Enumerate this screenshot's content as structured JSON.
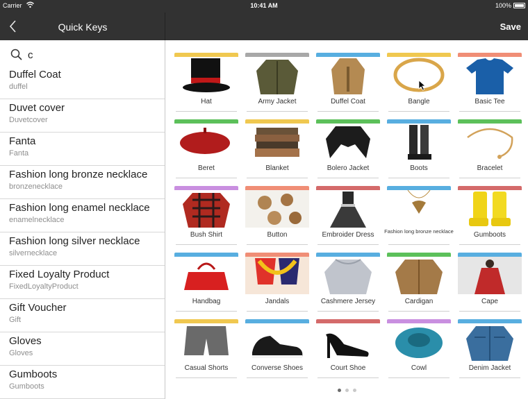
{
  "status_bar": {
    "carrier": "Carrier",
    "time": "10:41 AM",
    "battery": "100%"
  },
  "nav": {
    "title": "Quick Keys",
    "save": "Save"
  },
  "search": {
    "value": "c"
  },
  "list": [
    {
      "title": "Duffel Coat",
      "sub": "duffel"
    },
    {
      "title": "Duvet cover",
      "sub": "Duvetcover"
    },
    {
      "title": "Fanta",
      "sub": "Fanta"
    },
    {
      "title": "Fashion long bronze necklace",
      "sub": "bronzenecklace"
    },
    {
      "title": "Fashion long enamel necklace",
      "sub": "enamelnecklace"
    },
    {
      "title": "Fashion long silver necklace",
      "sub": "silvernecklace"
    },
    {
      "title": "Fixed Loyalty Product",
      "sub": "FixedLoyaltyProduct"
    },
    {
      "title": "Gift Voucher",
      "sub": "Gift"
    },
    {
      "title": "Gloves",
      "sub": "Gloves"
    },
    {
      "title": "Gumboots",
      "sub": "Gumboots"
    }
  ],
  "tiles": [
    {
      "label": "Hat",
      "color": "#f0c850",
      "icon": "hat"
    },
    {
      "label": "Army Jacket",
      "color": "#a8a8a8",
      "icon": "jacket-olive"
    },
    {
      "label": "Duffel Coat",
      "color": "#58aee0",
      "icon": "coat-camel"
    },
    {
      "label": "Bangle",
      "color": "#f0c850",
      "icon": "bangle"
    },
    {
      "label": "Basic Tee",
      "color": "#f08e76",
      "icon": "tee"
    },
    {
      "label": "Beret",
      "color": "#5cc05a",
      "icon": "beret"
    },
    {
      "label": "Blanket",
      "color": "#f0c850",
      "icon": "blanket"
    },
    {
      "label": "Bolero Jacket",
      "color": "#5cc05a",
      "icon": "bolero"
    },
    {
      "label": "Boots",
      "color": "#58aee0",
      "icon": "boots"
    },
    {
      "label": "Bracelet",
      "color": "#5cc05a",
      "icon": "bracelet"
    },
    {
      "label": "Bush Shirt",
      "color": "#c98fe0",
      "icon": "bush-shirt"
    },
    {
      "label": "Button",
      "color": "#f08e76",
      "icon": "buttons"
    },
    {
      "label": "Embroider Dress",
      "color": "#d46a6a",
      "icon": "dress"
    },
    {
      "label": "Fashion long bronze necklace",
      "color": "#58aee0",
      "icon": "necklace"
    },
    {
      "label": "Gumboots",
      "color": "#d46a6a",
      "icon": "gumboots"
    },
    {
      "label": "Handbag",
      "color": "#58aee0",
      "icon": "handbag"
    },
    {
      "label": "Jandals",
      "color": "#f08e76",
      "icon": "jandals"
    },
    {
      "label": "Cashmere Jersey",
      "color": "#58aee0",
      "icon": "jersey"
    },
    {
      "label": "Cardigan",
      "color": "#5cc05a",
      "icon": "cardigan"
    },
    {
      "label": "Cape",
      "color": "#58aee0",
      "icon": "cape"
    },
    {
      "label": "Casual Shorts",
      "color": "#f0c850",
      "icon": "shorts"
    },
    {
      "label": "Converse Shoes",
      "color": "#58aee0",
      "icon": "sneakers"
    },
    {
      "label": "Court Shoe",
      "color": "#d46a6a",
      "icon": "heels"
    },
    {
      "label": "Cowl",
      "color": "#c98fe0",
      "icon": "cowl"
    },
    {
      "label": "Denim Jacket",
      "color": "#58aee0",
      "icon": "denim-jacket"
    }
  ],
  "pager": {
    "pages": 3,
    "current": 0
  }
}
